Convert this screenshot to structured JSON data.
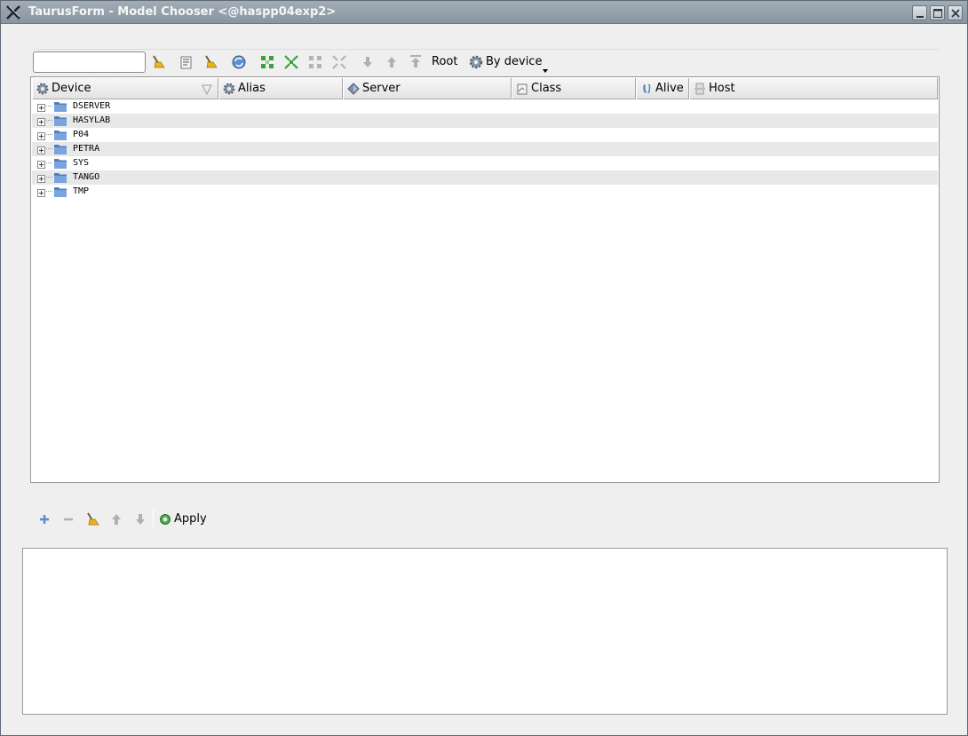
{
  "window": {
    "title": "TaurusForm - Model Chooser <@haspp04exp2>",
    "icons": {
      "app": "x-logo-icon",
      "minimize": "minimize-icon",
      "maximize": "maximize-icon",
      "close": "close-icon"
    }
  },
  "toolbar": {
    "filter": {
      "value": "",
      "placeholder": ""
    },
    "root_label": "Root",
    "view_mode_label": "By device",
    "icons": [
      "broom-icon",
      "notes-icon",
      "broom-icon",
      "refresh-icon",
      "expand-all-icon",
      "expand-selection-icon",
      "collapse-all-icon",
      "collapse-selection-icon",
      "arrow-down-icon",
      "arrow-up-icon",
      "arrow-top-icon",
      "gear-icon",
      "chevron-down-icon"
    ]
  },
  "tree": {
    "columns": [
      {
        "label": "Device",
        "icon": "gear-icon"
      },
      {
        "label": "Alias",
        "icon": "gear-icon"
      },
      {
        "label": "Server",
        "icon": "server-icon"
      },
      {
        "label": "Class",
        "icon": "class-icon"
      },
      {
        "label": "Alive",
        "icon": "alive-icon"
      },
      {
        "label": "Host",
        "icon": "host-icon"
      }
    ],
    "rows": [
      {
        "label": "DSERVER"
      },
      {
        "label": "HASYLAB"
      },
      {
        "label": "P04"
      },
      {
        "label": "PETRA"
      },
      {
        "label": "SYS"
      },
      {
        "label": "TANGO"
      },
      {
        "label": "TMP"
      }
    ]
  },
  "bottom_toolbar": {
    "apply_label": "Apply",
    "icons": [
      "plus-icon",
      "minus-icon",
      "broom-icon",
      "arrow-up-icon",
      "arrow-down-icon",
      "apply-icon"
    ]
  },
  "colors": {
    "titlebar": "#8e99a5",
    "window_bg": "#efefef",
    "alt_row": "#e8e8e8",
    "folder": "#6e9bd3",
    "expand_green": "#3ca03c"
  }
}
